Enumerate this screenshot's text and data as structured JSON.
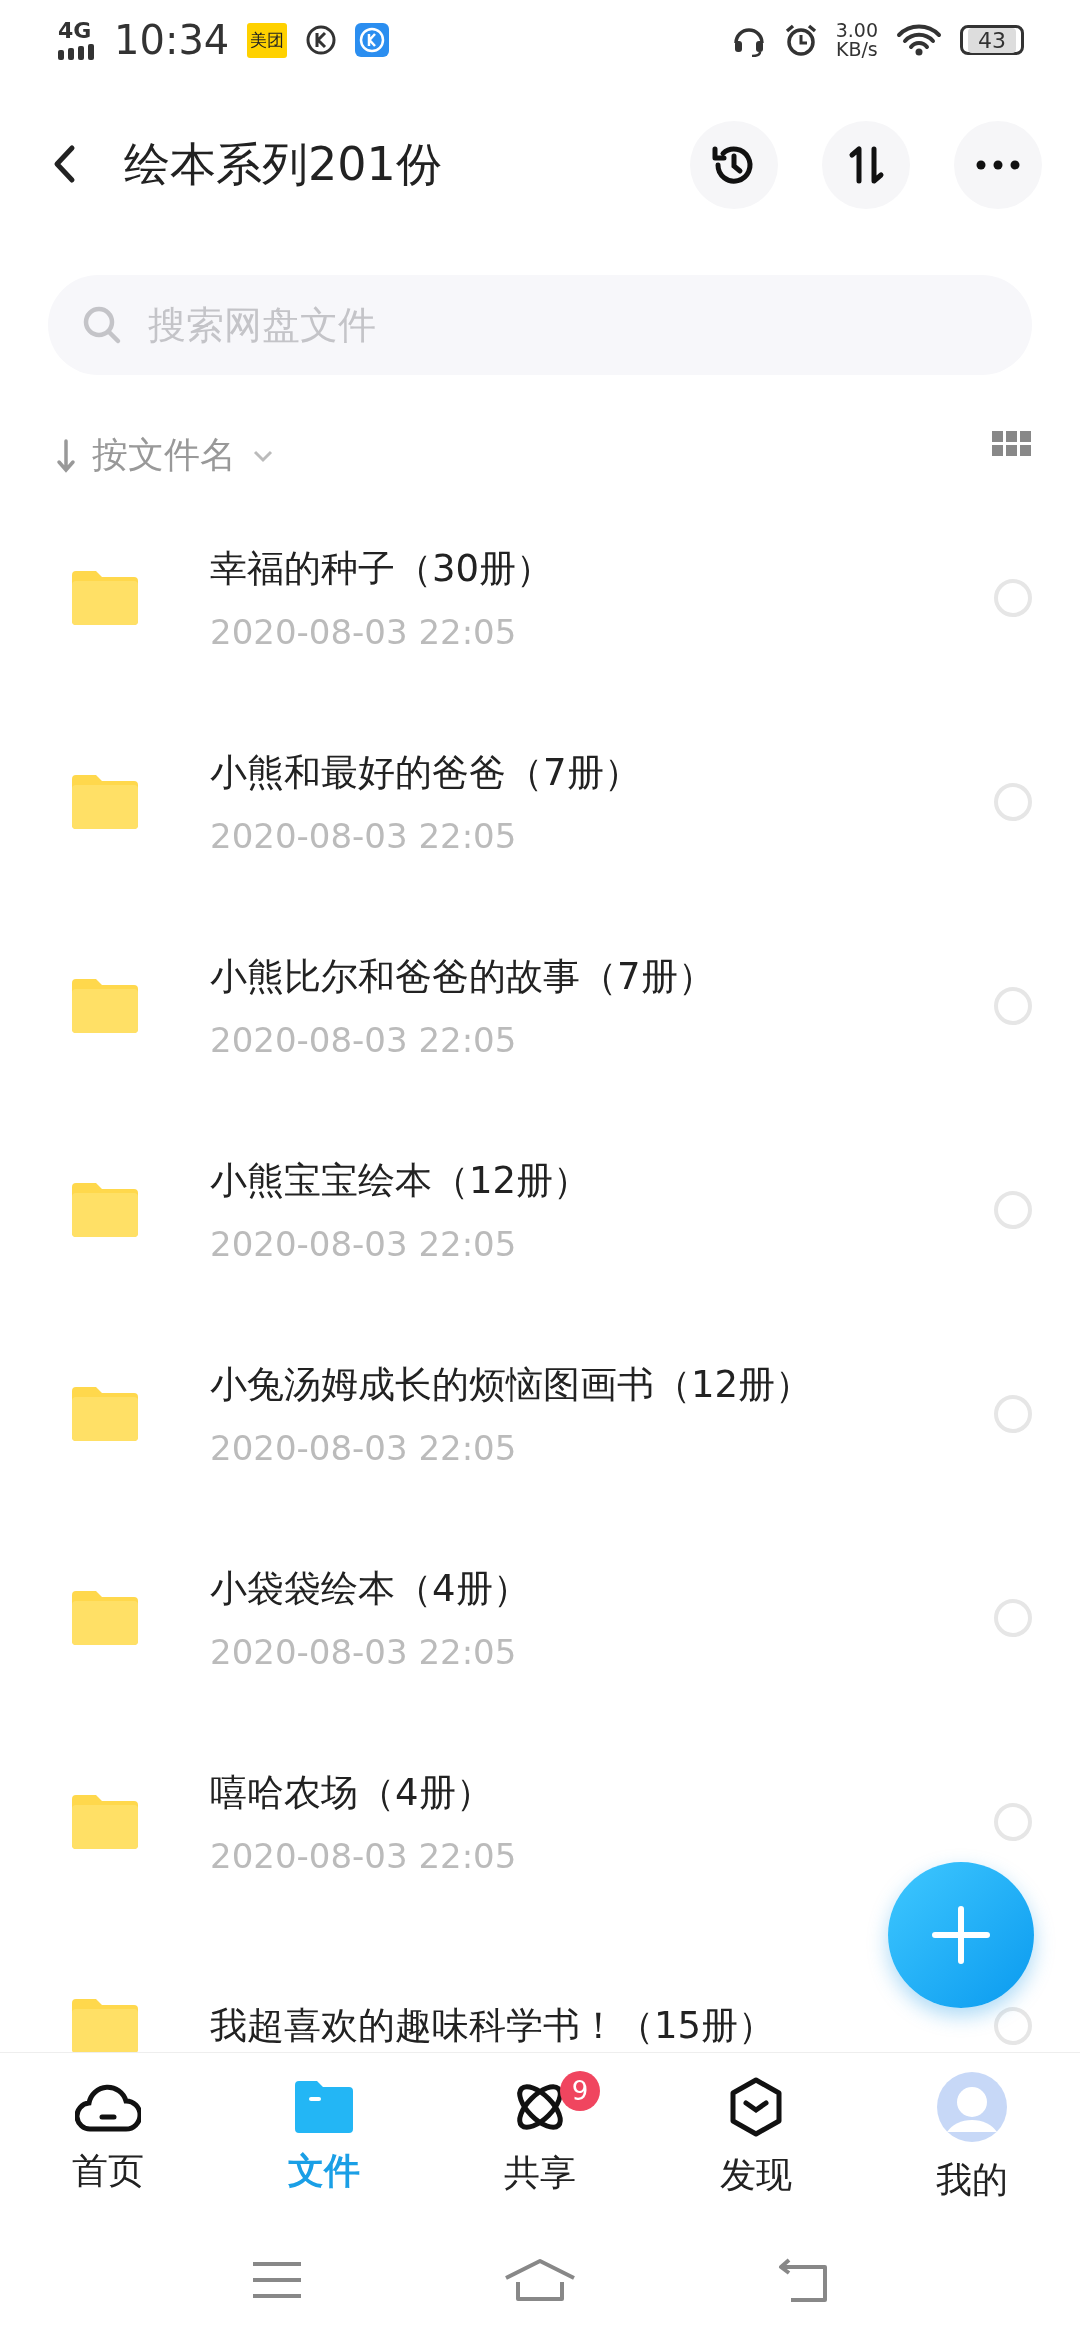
{
  "status_bar": {
    "network": "4G",
    "time": "10:34",
    "app_badge": "美团",
    "speed": "3.00",
    "speed_unit": "KB/s",
    "battery": "43"
  },
  "header": {
    "title": "绘本系列201份"
  },
  "search": {
    "placeholder": "搜索网盘文件"
  },
  "sort": {
    "label": "按文件名"
  },
  "files": [
    {
      "name": "幸福的种子（30册）",
      "date": "2020-08-03  22:05",
      "selected": false
    },
    {
      "name": "小熊和最好的爸爸（7册）",
      "date": "2020-08-03  22:05",
      "selected": false
    },
    {
      "name": "小熊比尔和爸爸的故事（7册）",
      "date": "2020-08-03  22:05",
      "selected": false
    },
    {
      "name": "小熊宝宝绘本（12册）",
      "date": "2020-08-03  22:05",
      "selected": false
    },
    {
      "name": "小兔汤姆成长的烦恼图画书（12册）",
      "date": "2020-08-03  22:05",
      "selected": false
    },
    {
      "name": "小袋袋绘本（4册）",
      "date": "2020-08-03  22:05",
      "selected": false
    },
    {
      "name": "嘻哈农场（4册）",
      "date": "2020-08-03  22:05",
      "selected": false
    },
    {
      "name": "我超喜欢的趣味科学书！（15册）",
      "selected": false
    }
  ],
  "tabs": [
    {
      "label": "首页",
      "selected": false
    },
    {
      "label": "文件",
      "selected": true
    },
    {
      "label": "共享",
      "selected": false,
      "badge": "9"
    },
    {
      "label": "发现",
      "selected": false
    },
    {
      "label": "我的",
      "selected": false
    }
  ]
}
